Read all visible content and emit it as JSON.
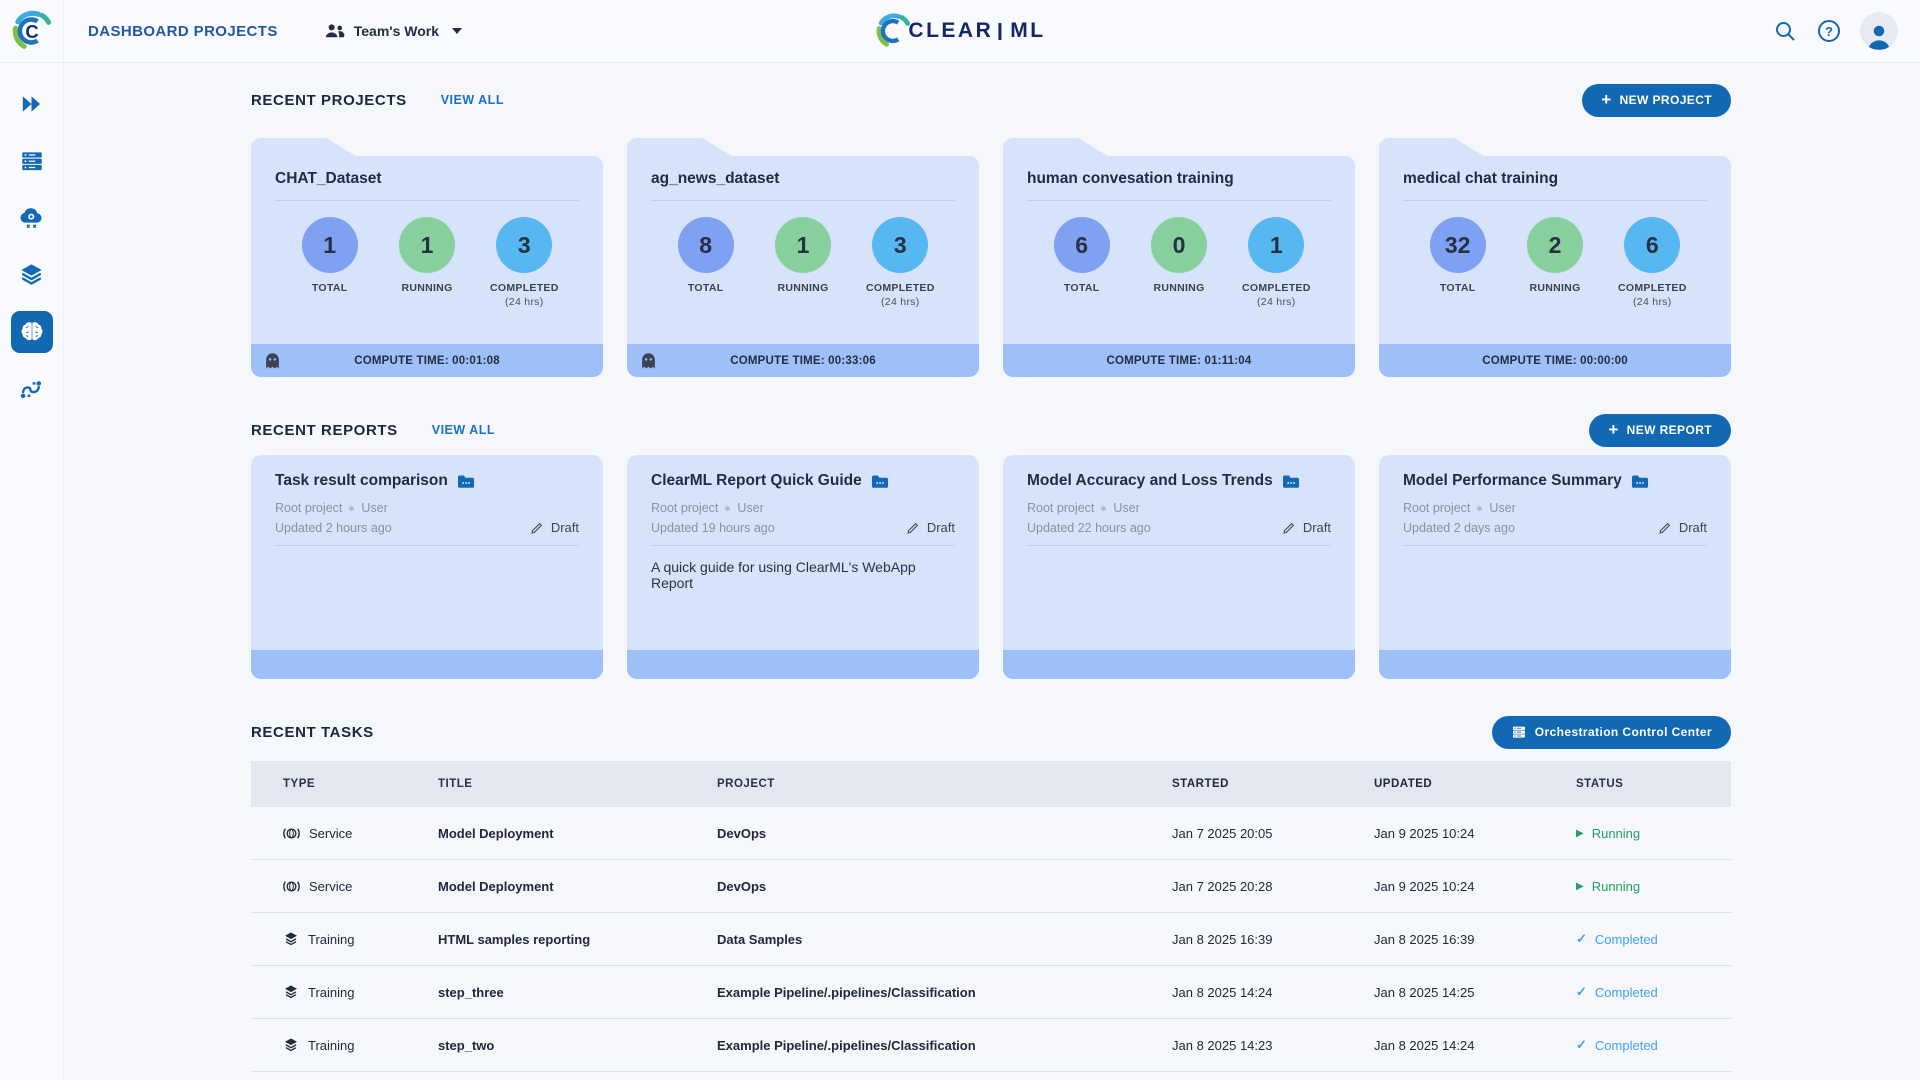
{
  "topbar": {
    "title": "DASHBOARD PROJECTS",
    "workspace": "Team's Work",
    "logo_left": "CLEAR",
    "logo_right": "ML",
    "help_glyph": "?"
  },
  "sidebar": {
    "items": [
      {
        "name": "expand"
      },
      {
        "name": "queues"
      },
      {
        "name": "workers"
      },
      {
        "name": "datasets"
      },
      {
        "name": "projects-dashboard",
        "active": true
      },
      {
        "name": "pipelines"
      }
    ]
  },
  "projects": {
    "section_title": "RECENT PROJECTS",
    "view_all": "VIEW ALL",
    "new_button": "NEW PROJECT",
    "plus": "+",
    "stat_labels": {
      "total": "TOTAL",
      "running": "RUNNING",
      "completed": "COMPLETED",
      "completed_sub": "(24 hrs)"
    },
    "cards": [
      {
        "name": "CHAT_Dataset",
        "total": "1",
        "running": "1",
        "completed": "3",
        "compute_time": "COMPUTE TIME: 00:01:08",
        "ghost": true
      },
      {
        "name": "ag_news_dataset",
        "total": "8",
        "running": "1",
        "completed": "3",
        "compute_time": "COMPUTE TIME: 00:33:06",
        "ghost": true
      },
      {
        "name": "human convesation training",
        "total": "6",
        "running": "0",
        "completed": "1",
        "compute_time": "COMPUTE TIME: 01:11:04",
        "ghost": false
      },
      {
        "name": "medical chat training",
        "total": "32",
        "running": "2",
        "completed": "6",
        "compute_time": "COMPUTE TIME: 00:00:00",
        "ghost": false
      }
    ]
  },
  "reports": {
    "section_title": "RECENT REPORTS",
    "view_all": "VIEW ALL",
    "new_button": "NEW REPORT",
    "plus": "+",
    "cards": [
      {
        "title": "Task result comparison",
        "project": "Root project",
        "author": "User",
        "updated": "Updated 2 hours ago",
        "badge": "Draft",
        "description": ""
      },
      {
        "title": "ClearML Report Quick Guide",
        "project": "Root project",
        "author": "User",
        "updated": "Updated 19 hours ago",
        "badge": "Draft",
        "description": "A quick guide for using ClearML's WebApp Report"
      },
      {
        "title": "Model Accuracy and Loss Trends",
        "project": "Root project",
        "author": "User",
        "updated": "Updated 22 hours ago",
        "badge": "Draft",
        "description": ""
      },
      {
        "title": "Model Performance Summary",
        "project": "Root project",
        "author": "User",
        "updated": "Updated 2 days ago",
        "badge": "Draft",
        "description": ""
      }
    ]
  },
  "tasks": {
    "section_title": "RECENT TASKS",
    "occ_button": "Orchestration Control Center",
    "columns": {
      "type": "TYPE",
      "title": "TITLE",
      "project": "PROJECT",
      "started": "STARTED",
      "updated": "UPDATED",
      "status": "STATUS"
    },
    "rows": [
      {
        "type": "Service",
        "title": "Model Deployment",
        "project": "DevOps",
        "started": "Jan 7 2025 20:05",
        "updated": "Jan 9 2025 10:24",
        "status": "Running"
      },
      {
        "type": "Service",
        "title": "Model Deployment",
        "project": "DevOps",
        "started": "Jan 7 2025 20:28",
        "updated": "Jan 9 2025 10:24",
        "status": "Running"
      },
      {
        "type": "Training",
        "title": "HTML samples reporting",
        "project": "Data Samples",
        "started": "Jan 8 2025 16:39",
        "updated": "Jan 8 2025 16:39",
        "status": "Completed"
      },
      {
        "type": "Training",
        "title": "step_three",
        "project": "Example Pipeline/.pipelines/Classification",
        "started": "Jan 8 2025 14:24",
        "updated": "Jan 8 2025 14:25",
        "status": "Completed"
      },
      {
        "type": "Training",
        "title": "step_two",
        "project": "Example Pipeline/.pipelines/Classification",
        "started": "Jan 8 2025 14:23",
        "updated": "Jan 8 2025 14:24",
        "status": "Completed"
      }
    ],
    "status_icons": {
      "running": "▶",
      "completed": "✓"
    }
  },
  "colors": {
    "accent": "#1268b3",
    "card_bg": "#d6e3fb",
    "card_footer_bg": "#9cc0f7",
    "total_circle": "#7ea1f2",
    "running_circle": "#87cf9d",
    "completed_circle": "#57b7f0",
    "running_status": "#23a066",
    "completed_status": "#41a3ef"
  }
}
